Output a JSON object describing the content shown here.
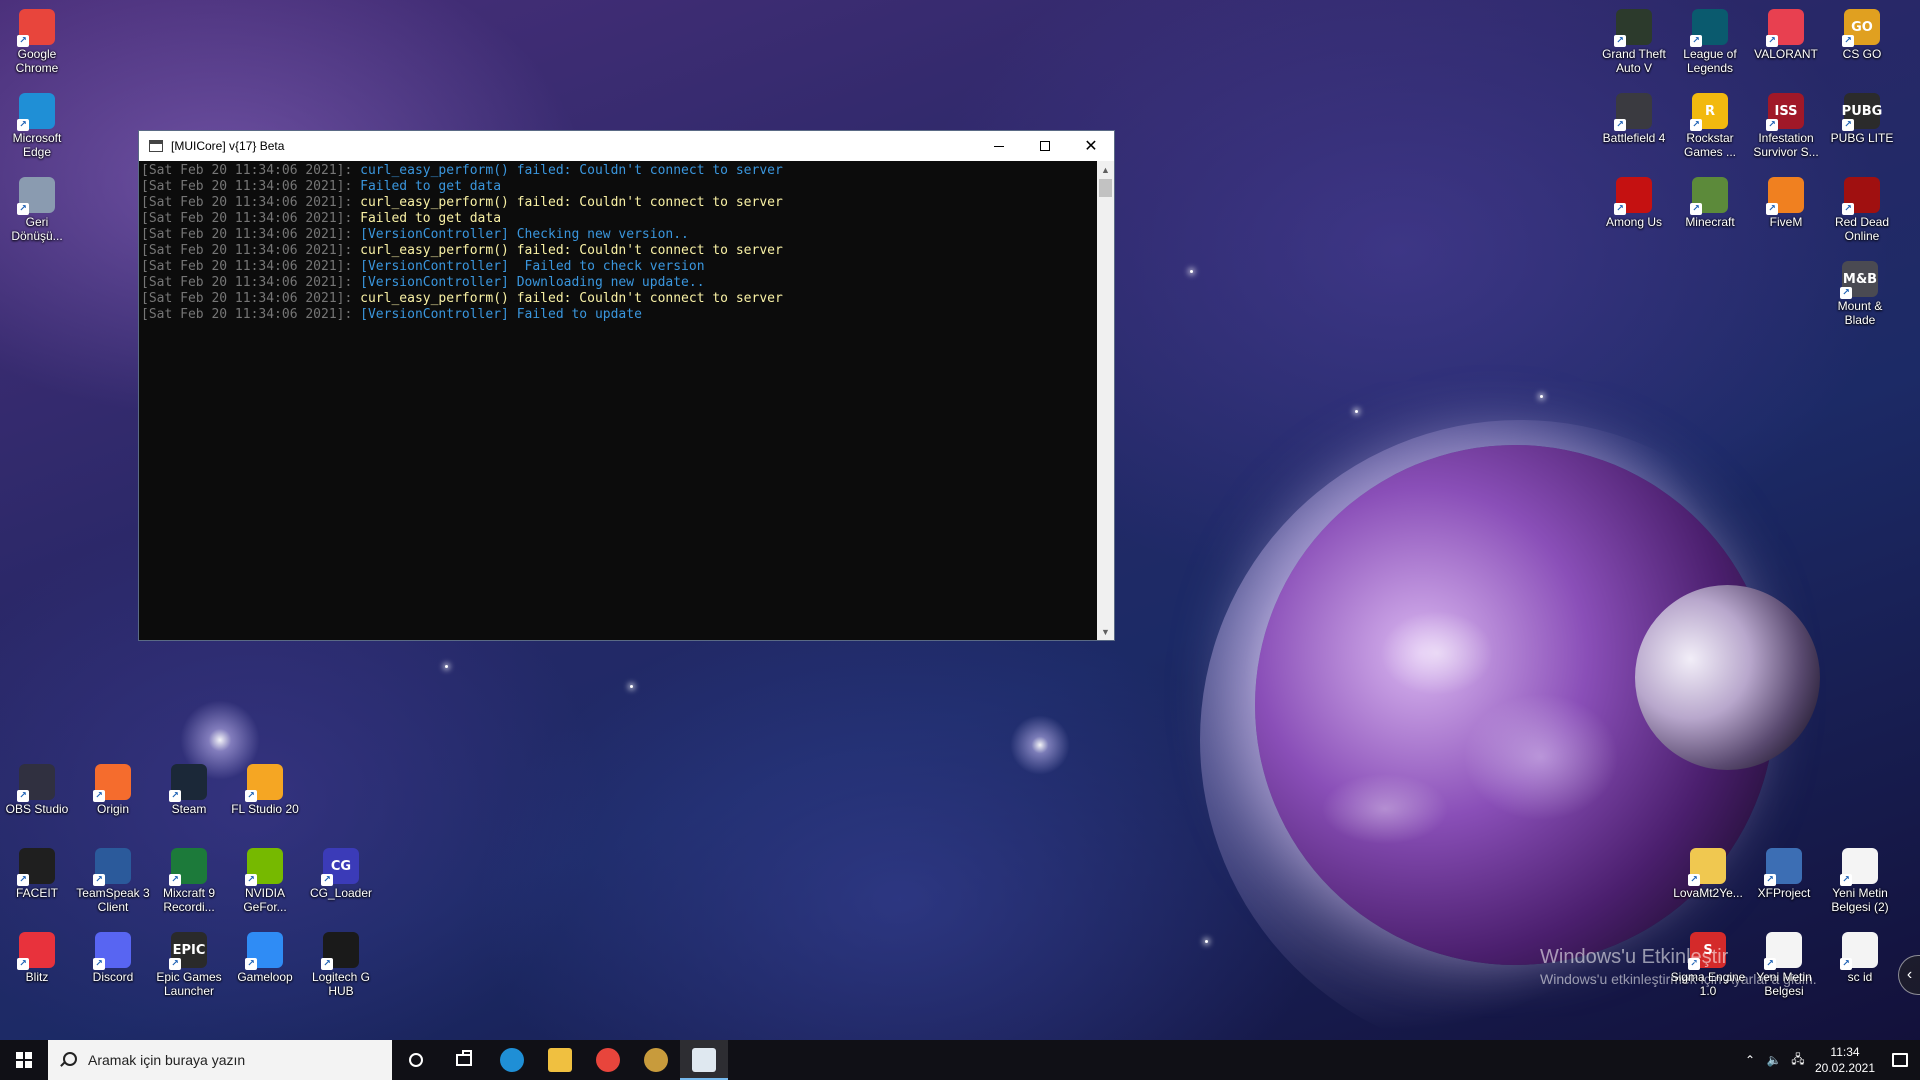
{
  "desktop": {
    "icons_left_top": [
      {
        "label": "Google Chrome",
        "icon": "chrome-icon",
        "color": "#e8453c"
      },
      {
        "label": "Microsoft Edge",
        "icon": "edge-icon",
        "color": "#1f8fd6"
      },
      {
        "label": "Geri Dönüşü...",
        "icon": "recycle-bin-icon",
        "color": "#8a9bb0"
      }
    ],
    "icons_bottom_left_row1": [
      {
        "label": "OBS Studio",
        "icon": "obs-icon",
        "color": "#303040"
      },
      {
        "label": "Origin",
        "icon": "origin-icon",
        "color": "#f56c2d"
      },
      {
        "label": "Steam",
        "icon": "steam-icon",
        "color": "#1b2838"
      },
      {
        "label": "FL Studio 20",
        "icon": "fl-studio-icon",
        "color": "#f5a623"
      }
    ],
    "icons_bottom_left_row2": [
      {
        "label": "FACEIT",
        "icon": "faceit-icon",
        "color": "#1f1f1f"
      },
      {
        "label": "TeamSpeak 3 Client",
        "icon": "teamspeak-icon",
        "color": "#2b5a9b"
      },
      {
        "label": "Mixcraft 9 Recordi...",
        "icon": "mixcraft-icon",
        "color": "#1c7a3a"
      },
      {
        "label": "NVIDIA GeFor...",
        "icon": "nvidia-icon",
        "color": "#76b900"
      },
      {
        "label": "CG_Loader",
        "icon": "cg-loader-icon",
        "color": "#3b3bb8",
        "text": "CG"
      }
    ],
    "icons_bottom_left_row3": [
      {
        "label": "Blitz",
        "icon": "blitz-icon",
        "color": "#e8323c"
      },
      {
        "label": "Discord",
        "icon": "discord-icon",
        "color": "#5865f2"
      },
      {
        "label": "Epic Games Launcher",
        "icon": "epic-games-icon",
        "color": "#2a2a2a",
        "text": "EPIC"
      },
      {
        "label": "Gameloop",
        "icon": "gameloop-icon",
        "color": "#2f8cf5"
      },
      {
        "label": "Logitech G HUB",
        "icon": "logitech-icon",
        "color": "#1a1a1a"
      }
    ],
    "icons_right_top": [
      [
        {
          "label": "Grand Theft Auto V",
          "icon": "gta-icon",
          "color": "#2c3a2c"
        },
        {
          "label": "League of Legends",
          "icon": "lol-icon",
          "color": "#0a5a6e"
        },
        {
          "label": "VALORANT",
          "icon": "valorant-icon",
          "color": "#e84050"
        },
        {
          "label": "CS GO",
          "icon": "csgo-icon",
          "color": "#e0a020",
          "text": "GO"
        }
      ],
      [
        {
          "label": "Battlefield 4",
          "icon": "battlefield-icon",
          "color": "#3a3a40"
        },
        {
          "label": "Rockstar Games ...",
          "icon": "rockstar-icon",
          "color": "#f2b90f",
          "text": "R"
        },
        {
          "label": "Infestation Survivor S...",
          "icon": "infestation-icon",
          "color": "#a01828",
          "text": "ISS"
        },
        {
          "label": "PUBG LITE",
          "icon": "pubg-icon",
          "color": "#2b2b2b",
          "text": "PUBG"
        }
      ],
      [
        {
          "label": "Among Us",
          "icon": "among-us-icon",
          "color": "#c51111"
        },
        {
          "label": "Minecraft",
          "icon": "minecraft-icon",
          "color": "#5c8a3a"
        },
        {
          "label": "FiveM",
          "icon": "fivem-icon",
          "color": "#f08020"
        },
        {
          "label": "Red Dead Online",
          "icon": "red-dead-icon",
          "color": "#a01010"
        }
      ],
      [
        {
          "label": "Mount & Blade",
          "icon": "mount-blade-icon",
          "color": "#4a4a52",
          "text": "M&B"
        }
      ]
    ],
    "icons_bottom_right_row1": [
      {
        "label": "LovaMt2Ye...",
        "icon": "folder-icon",
        "color": "#f0c850"
      },
      {
        "label": "XFProject",
        "icon": "xfproject-icon",
        "color": "#3c6eb4"
      },
      {
        "label": "Yeni Metin Belgesi (2)",
        "icon": "text-file-icon",
        "color": "#f4f4f4"
      }
    ],
    "icons_bottom_right_row2": [
      {
        "label": "Sigma Engine 1.0",
        "icon": "sigma-engine-icon",
        "color": "#d42a2a",
        "text": "S"
      },
      {
        "label": "Yeni Metin Belgesi",
        "icon": "text-file-icon",
        "color": "#f4f4f4"
      },
      {
        "label": "sc id",
        "icon": "text-file-icon",
        "color": "#f4f4f4"
      }
    ],
    "watermark": {
      "title": "Windows'u Etkinleştir",
      "subtitle": "Windows'u etkinleştirmek için Ayarlar'a gidin."
    }
  },
  "window": {
    "title": "[MUICore] v{17} Beta",
    "colors": {
      "timestamp": "#767676",
      "cyan": "#3a96dd",
      "yellow": "#f9f1a5"
    },
    "lines": [
      {
        "ts": "[Sat Feb 20 11:34:06 2021]: ",
        "msg": "curl_easy_perform() failed: Couldn't connect to server",
        "tone": "cyan"
      },
      {
        "ts": "[Sat Feb 20 11:34:06 2021]: ",
        "msg": "Failed to get data",
        "tone": "cyan"
      },
      {
        "ts": "[Sat Feb 20 11:34:06 2021]: ",
        "msg": "curl_easy_perform() failed: Couldn't connect to server",
        "tone": "yellow"
      },
      {
        "ts": "[Sat Feb 20 11:34:06 2021]: ",
        "msg": "Failed to get data",
        "tone": "yellow"
      },
      {
        "ts": "[Sat Feb 20 11:34:06 2021]: ",
        "msg": "[VersionController] Checking new version..",
        "tone": "cyan"
      },
      {
        "ts": "[Sat Feb 20 11:34:06 2021]: ",
        "msg": "curl_easy_perform() failed: Couldn't connect to server",
        "tone": "yellow"
      },
      {
        "ts": "[Sat Feb 20 11:34:06 2021]: ",
        "msg": "[VersionController]  Failed to check version",
        "tone": "cyan"
      },
      {
        "ts": "[Sat Feb 20 11:34:06 2021]: ",
        "msg": "[VersionController] Downloading new update..",
        "tone": "cyan"
      },
      {
        "ts": "[Sat Feb 20 11:34:06 2021]: ",
        "msg": "curl_easy_perform() failed: Couldn't connect to server",
        "tone": "yellow"
      },
      {
        "ts": "[Sat Feb 20 11:34:06 2021]: ",
        "msg": "[VersionController] Failed to update",
        "tone": "cyan"
      }
    ]
  },
  "taskbar": {
    "search_placeholder": "Aramak için buraya yazın",
    "pinned": [
      {
        "icon": "edge-icon",
        "color": "#1f8fd6"
      },
      {
        "icon": "file-explorer-icon",
        "color": "#f0c040"
      },
      {
        "icon": "chrome-icon",
        "color": "#e8453c"
      },
      {
        "icon": "league-client-icon",
        "color": "#c89b3c"
      },
      {
        "icon": "console-app-icon",
        "color": "#dfe8f0",
        "active": true
      }
    ],
    "time": "11:34",
    "date": "20.02.2021"
  }
}
